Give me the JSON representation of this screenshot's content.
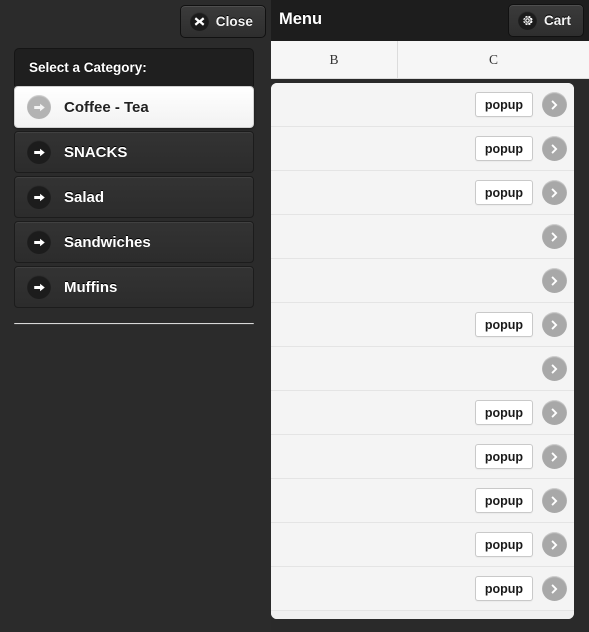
{
  "left_panel": {
    "close_button": {
      "label": "Close",
      "icon": "close-x-icon"
    },
    "category_header": "Select a Category:",
    "categories": [
      {
        "label": "Coffee - Tea",
        "icon": "arrow-right-icon",
        "selected": true
      },
      {
        "label": "SNACKS",
        "icon": "arrow-right-icon",
        "selected": false
      },
      {
        "label": "Salad",
        "icon": "arrow-right-icon",
        "selected": false
      },
      {
        "label": "Sandwiches",
        "icon": "arrow-right-icon",
        "selected": false
      },
      {
        "label": "Muffins",
        "icon": "arrow-right-icon",
        "selected": false
      }
    ]
  },
  "right_panel": {
    "title": "Menu",
    "cart_button": {
      "label": "Cart",
      "icon": "gear-icon"
    },
    "columns": [
      {
        "key": "B",
        "label": "B"
      },
      {
        "key": "C",
        "label": "C"
      }
    ],
    "rows": [
      {
        "b": "",
        "c": "",
        "popup_label": "popup",
        "has_popup": true,
        "chevron": "chevron-right-icon"
      },
      {
        "b": "",
        "c": "",
        "popup_label": "popup",
        "has_popup": true,
        "chevron": "chevron-right-icon"
      },
      {
        "b": "",
        "c": "",
        "popup_label": "popup",
        "has_popup": true,
        "chevron": "chevron-right-icon"
      },
      {
        "b": "",
        "c": "",
        "popup_label": "",
        "has_popup": false,
        "chevron": "chevron-right-icon"
      },
      {
        "b": "",
        "c": "",
        "popup_label": "",
        "has_popup": false,
        "chevron": "chevron-right-icon"
      },
      {
        "b": "",
        "c": "",
        "popup_label": "popup",
        "has_popup": true,
        "chevron": "chevron-right-icon"
      },
      {
        "b": "",
        "c": "",
        "popup_label": "",
        "has_popup": false,
        "chevron": "chevron-right-icon"
      },
      {
        "b": "",
        "c": "",
        "popup_label": "popup",
        "has_popup": true,
        "chevron": "chevron-right-icon"
      },
      {
        "b": "",
        "c": "",
        "popup_label": "popup",
        "has_popup": true,
        "chevron": "chevron-right-icon"
      },
      {
        "b": "",
        "c": "",
        "popup_label": "popup",
        "has_popup": true,
        "chevron": "chevron-right-icon"
      },
      {
        "b": "",
        "c": "",
        "popup_label": "popup",
        "has_popup": true,
        "chevron": "chevron-right-icon"
      },
      {
        "b": "",
        "c": "",
        "popup_label": "popup",
        "has_popup": true,
        "chevron": "chevron-right-icon"
      }
    ]
  },
  "colors": {
    "panel_dark": "#2b2b2b",
    "header_dark": "#1d1d1d",
    "row_bg": "#f4f4f4",
    "chevron_gray": "#a8a8a8",
    "selected_bg": "#ffffff"
  }
}
